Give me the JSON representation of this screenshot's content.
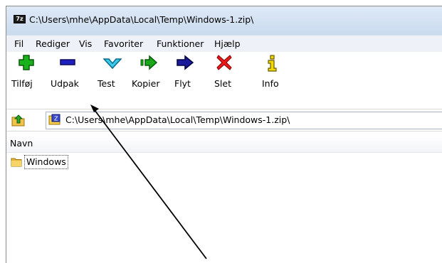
{
  "window": {
    "app_icon_text": "7z",
    "title": "C:\\Users\\mhe\\AppData\\Local\\Temp\\Windows-1.zip\\"
  },
  "menubar": {
    "items": [
      "Fil",
      "Rediger",
      "Vis",
      "Favoriter",
      "Funktioner",
      "Hjælp"
    ]
  },
  "toolbar": {
    "buttons": [
      {
        "label": "Tilføj",
        "icon": "add-plus-icon",
        "color": "#1aa51a"
      },
      {
        "label": "Udpak",
        "icon": "extract-minus-icon",
        "color": "#1c1cb0"
      },
      {
        "label": "Test",
        "icon": "test-check-icon",
        "color": "#22b8d8"
      },
      {
        "label": "Kopier",
        "icon": "copy-arrow-icon",
        "color": "#15a015"
      },
      {
        "label": "Flyt",
        "icon": "move-arrow-icon",
        "color": "#1a1a8c"
      },
      {
        "label": "Slet",
        "icon": "delete-x-icon",
        "color": "#e01010"
      },
      {
        "label": "Info",
        "icon": "info-i-icon",
        "color": "#c8b400"
      }
    ]
  },
  "addressbar": {
    "path": "C:\\Users\\mhe\\AppData\\Local\\Temp\\Windows-1.zip\\"
  },
  "list": {
    "columns": [
      "Navn"
    ],
    "rows": [
      {
        "name": "Windows",
        "icon": "folder-icon"
      }
    ]
  }
}
